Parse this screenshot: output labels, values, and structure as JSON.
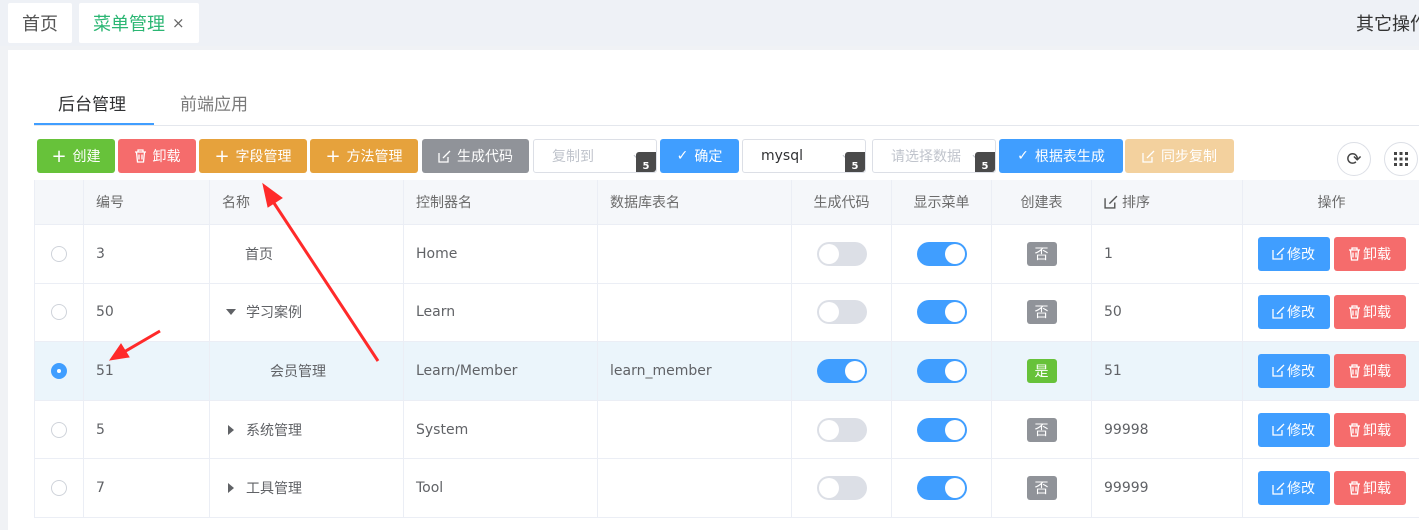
{
  "top_tabs": {
    "home": "首页",
    "menu": "菜单管理",
    "close": "×",
    "other_ops": "其它操作"
  },
  "main_tabs": {
    "backend": "后台管理",
    "frontend": "前端应用"
  },
  "toolbar": {
    "create": "创建",
    "delete": "卸载",
    "field_manage": "字段管理",
    "method_manage": "方法管理",
    "gen_code": "生成代码",
    "copy_to_placeholder": "复制到",
    "confirm": "确定",
    "db_value": "mysql",
    "select_db_placeholder": "请选择数据",
    "gen_from_table": "根据表生成",
    "sync_copy": "同步复制",
    "h5_badge": "5"
  },
  "table": {
    "headers": [
      "编号",
      "名称",
      "控制器名",
      "数据库表名",
      "生成代码",
      "显示菜单",
      "创建表",
      "排序",
      "操作"
    ],
    "rows": [
      {
        "id": "3",
        "name": "首页",
        "controller": "Home",
        "table": "",
        "gen": false,
        "show": true,
        "created": "否",
        "sort": "1",
        "selected": false
      },
      {
        "id": "50",
        "name": "学习案例",
        "controller": "Learn",
        "table": "",
        "gen": false,
        "show": true,
        "created": "否",
        "sort": "50",
        "selected": false
      },
      {
        "id": "51",
        "name": "会员管理",
        "controller": "Learn/Member",
        "table": "learn_member",
        "gen": true,
        "show": true,
        "created": "是",
        "sort": "51",
        "selected": true
      },
      {
        "id": "5",
        "name": "系统管理",
        "controller": "System",
        "table": "",
        "gen": false,
        "show": true,
        "created": "否",
        "sort": "99998",
        "selected": false
      },
      {
        "id": "7",
        "name": "工具管理",
        "controller": "Tool",
        "table": "",
        "gen": false,
        "show": true,
        "created": "否",
        "sort": "99999",
        "selected": false
      }
    ],
    "edit_label": "修改",
    "delete_label": "卸载"
  },
  "colors": {
    "green": "#67c23a",
    "red": "#f56c6c",
    "orange": "#e6a23c",
    "blue": "#409eff",
    "annotation": "#ff2a2a"
  }
}
